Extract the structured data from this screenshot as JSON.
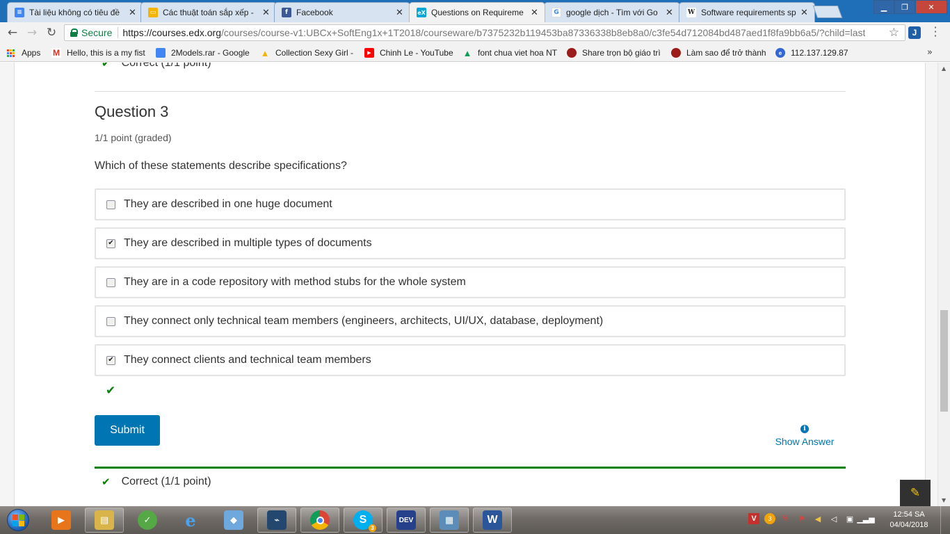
{
  "browser": {
    "tabs": [
      {
        "title": "Tài liệu không có tiêu đề",
        "icon": "docs-icon",
        "color": "#4285f4",
        "glyph": "≡"
      },
      {
        "title": "Các thuật toán sắp xếp -",
        "icon": "slides-icon",
        "color": "#f4b400",
        "glyph": "▭"
      },
      {
        "title": "Facebook",
        "icon": "facebook-icon",
        "color": "#3b5998",
        "glyph": "f"
      },
      {
        "title": "Questions on Requireme",
        "icon": "edx-icon",
        "color": "#02a6d8",
        "glyph": "eX"
      },
      {
        "title": "google dịch - Tìm với Go",
        "icon": "google-icon",
        "color": "#ea4335",
        "glyph": "G"
      },
      {
        "title": "Software requirements sp",
        "icon": "wikipedia-icon",
        "color": "#ffffff",
        "glyph": "W"
      }
    ],
    "tab_close": "✕",
    "window_controls": {
      "minimize": "▁",
      "maximize": "❐",
      "close": "✕"
    },
    "address": {
      "secure_label": "Secure",
      "url_base": "https://courses.edx.org",
      "url_rest": "/courses/course-v1:UBCx+SoftEng1x+1T2018/courseware/b7375232b119453ba87336338b8eb8a0/c3fe54d712084bd487aed1f8fa9bb6a5/?child=last"
    },
    "bookmarks": [
      {
        "label": "Apps",
        "icon": "apps-grid-icon"
      },
      {
        "label": "Hello, this is a my fist",
        "icon": "gmail-icon",
        "color": "#d93025",
        "glyph": "M"
      },
      {
        "label": "2Models.rar - Google",
        "icon": "file-icon",
        "color": "#4285f4",
        "glyph": ""
      },
      {
        "label": "Collection Sexy Girl -",
        "icon": "drive-icon",
        "color": "#f4b400",
        "glyph": "▲"
      },
      {
        "label": "Chinh Le - YouTube",
        "icon": "youtube-icon",
        "color": "#ff0000",
        "glyph": "▶"
      },
      {
        "label": "font chua viet hoa NT",
        "icon": "drive-icon",
        "color": "#0f9d58",
        "glyph": "▲"
      },
      {
        "label": "Share trọn bộ giáo trì",
        "icon": "forum-icon",
        "color": "#9c1c1c",
        "glyph": "●"
      },
      {
        "label": "Làm sao để trở thành",
        "icon": "forum-icon",
        "color": "#9c1c1c",
        "glyph": "●"
      },
      {
        "label": "112.137.129.87",
        "icon": "globe-icon",
        "color": "#3367d6",
        "glyph": "e"
      }
    ],
    "bookmarks_more": "»"
  },
  "page": {
    "prev_result": "Correct (1/1 point)",
    "question_title": "Question 3",
    "points": "1/1 point (graded)",
    "prompt": "Which of these statements describe specifications?",
    "choices": [
      {
        "label": "They are described in one huge document",
        "checked": false
      },
      {
        "label": "They are described in multiple types of documents",
        "checked": true
      },
      {
        "label": "They are in a code repository with method stubs for the whole system",
        "checked": false
      },
      {
        "label": "They connect only technical team members (engineers, architects, UI/UX, database, deployment)",
        "checked": false
      },
      {
        "label": "They connect clients and technical team members",
        "checked": true
      }
    ],
    "submit_label": "Submit",
    "show_answer_label": "Show Answer",
    "bottom_result": "Correct (1/1 point)",
    "accent_color": "#0075b4",
    "correct_color": "#008100"
  },
  "taskbar": {
    "items": [
      {
        "name": "media-player-icon",
        "color": "#e8751a",
        "glyph": "▶"
      },
      {
        "name": "explorer-icon",
        "color": "#d9b44a",
        "glyph": "▤"
      },
      {
        "name": "coccoc-icon",
        "color": "#54a846",
        "glyph": "✓"
      },
      {
        "name": "ie-icon",
        "color": "#1e88e5",
        "glyph": "e"
      },
      {
        "name": "virtualbox-icon",
        "color": "#6fa8dc",
        "glyph": "◆"
      },
      {
        "name": "mysql-workbench-icon",
        "color": "#23476e",
        "glyph": "⌁"
      },
      {
        "name": "chrome-icon",
        "color": "#dd4b39",
        "glyph": "◉"
      },
      {
        "name": "skype-icon",
        "color": "#00aff0",
        "glyph": "S"
      },
      {
        "name": "devcpp-icon",
        "color": "#27408b",
        "glyph": "DEV"
      },
      {
        "name": "control-panel-icon",
        "color": "#5b8db8",
        "glyph": "▦"
      },
      {
        "name": "word-icon",
        "color": "#2b579a",
        "glyph": "W"
      }
    ],
    "tray_icons": [
      "vivaldi-icon",
      "notification-badge-icon",
      "shield-icon",
      "flag-icon",
      "speaker-icon",
      "volume-icon",
      "network-icon",
      "signal-icon"
    ],
    "skype_badge": "3",
    "time": "12:54 SA",
    "date": "04/04/2018"
  }
}
